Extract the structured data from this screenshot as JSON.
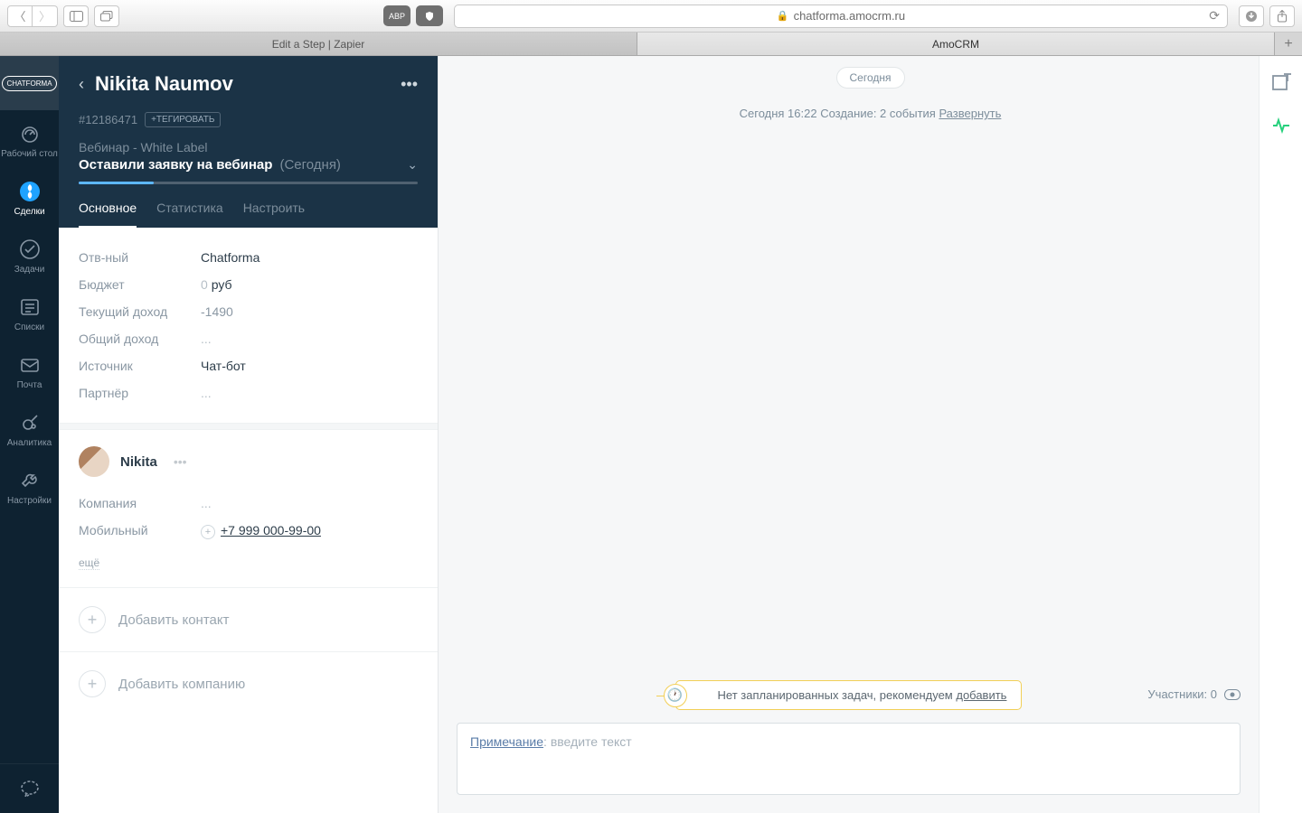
{
  "browser": {
    "address": "chatforma.amocrm.ru",
    "tabs": [
      "Edit a Step | Zapier",
      "AmoCRM"
    ]
  },
  "nav": {
    "logo": "CHATFORMA",
    "items": [
      {
        "id": "desktop",
        "label": "Рабочий стол"
      },
      {
        "id": "deals",
        "label": "Сделки"
      },
      {
        "id": "tasks",
        "label": "Задачи"
      },
      {
        "id": "lists",
        "label": "Списки"
      },
      {
        "id": "mail",
        "label": "Почта"
      },
      {
        "id": "analytics",
        "label": "Аналитика"
      },
      {
        "id": "settings",
        "label": "Настройки"
      }
    ]
  },
  "lead": {
    "name": "Nikita Naumov",
    "id": "#12186471",
    "tag_action": "+ТЕГИРОВАТЬ",
    "webinar": "Вебинар - White Label",
    "stage": "Оставили заявку на вебинар",
    "stage_when": "(Сегодня)"
  },
  "ptabs": {
    "main": "Основное",
    "stats": "Статистика",
    "setup": "Настроить"
  },
  "fields": {
    "responsible": {
      "label": "Отв-ный",
      "value": "Chatforma"
    },
    "budget": {
      "label": "Бюджет",
      "value": "0",
      "unit": "руб"
    },
    "current_income": {
      "label": "Текущий доход",
      "value": "-1490"
    },
    "total_income": {
      "label": "Общий доход",
      "value": "..."
    },
    "source": {
      "label": "Источник",
      "value": "Чат-бот"
    },
    "partner": {
      "label": "Партнёр",
      "value": "..."
    }
  },
  "contact": {
    "name": "Nikita",
    "company": {
      "label": "Компания",
      "value": "..."
    },
    "mobile": {
      "label": "Мобильный",
      "value": "+7 999 000-99-00"
    },
    "more": "ещё"
  },
  "add": {
    "contact": "Добавить контакт",
    "company": "Добавить компанию"
  },
  "feed": {
    "date_pill": "Сегодня",
    "event": "Сегодня 16:22 Создание: 2 события ",
    "expand": "Развернуть"
  },
  "task_banner": {
    "text": "Нет запланированных задач, рекомендуем ",
    "action": "добавить"
  },
  "participants": {
    "label": "Участники: ",
    "count": "0"
  },
  "note": {
    "type": "Примечание",
    "sep": ": ",
    "placeholder": "введите текст"
  }
}
